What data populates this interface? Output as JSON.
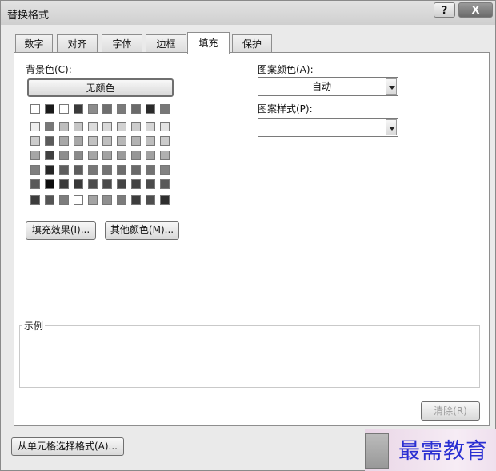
{
  "window": {
    "title": "替换格式",
    "help_label": "?",
    "close_label": "X"
  },
  "tabs": [
    {
      "label": "数字",
      "active": false
    },
    {
      "label": "对齐",
      "active": false
    },
    {
      "label": "字体",
      "active": false
    },
    {
      "label": "边框",
      "active": false
    },
    {
      "label": "填充",
      "active": true
    },
    {
      "label": "保护",
      "active": false
    }
  ],
  "fill": {
    "background_color_label": "背景色(C):",
    "no_color_button": "无颜色",
    "fill_effects_button": "填充效果(I)...",
    "more_colors_button": "其他颜色(M)...",
    "palette_top_row": [
      "#ffffff",
      "#1a1a1a",
      "#ffffff",
      "#3a3a3a",
      "#8c8c8c",
      "#6e6e6e",
      "#7a7a7a",
      "#6a6a6a",
      "#2a2a2a",
      "#777777"
    ],
    "palette_rows": [
      [
        "#eeeeee",
        "#777777",
        "#bdbdbd",
        "#c6c6c6",
        "#dcdcdc",
        "#d9d9d9",
        "#d2d2d2",
        "#cdcdcd",
        "#d6d6d6",
        "#e3e3e3"
      ],
      [
        "#cccccc",
        "#5b5b5b",
        "#a8a8a8",
        "#a7a7a7",
        "#c2c2c2",
        "#bfbfbf",
        "#b8b8b8",
        "#b3b3b3",
        "#bdbdbd",
        "#cbcbcb"
      ],
      [
        "#a6a6a6",
        "#404040",
        "#8e8e8e",
        "#8a8a8a",
        "#a5a5a5",
        "#a2a2a2",
        "#9b9b9b",
        "#979797",
        "#a1a1a1",
        "#b0b0b0"
      ],
      [
        "#7f7f7f",
        "#262626",
        "#5e5e5e",
        "#5d5d5d",
        "#777777",
        "#737373",
        "#6d6d6d",
        "#696969",
        "#727272",
        "#828282"
      ],
      [
        "#595959",
        "#0d0d0d",
        "#3a3a3a",
        "#393939",
        "#4c4c4c",
        "#4a4a4a",
        "#454545",
        "#434343",
        "#4b4b4b",
        "#585858"
      ],
      [
        "#3c3c3c",
        "#555555",
        "#7d7d7d",
        "#ffffff",
        "#a4a4a4",
        "#8f8f8f",
        "#7b7b7b",
        "#3d3d3d",
        "#4e4e4e",
        "#2e2e2e"
      ]
    ],
    "pattern_color_label": "图案颜色(A):",
    "pattern_color_value": "自动",
    "pattern_style_label": "图案样式(P):",
    "pattern_style_value": ""
  },
  "sample": {
    "label": "示例",
    "clear_button": "清除(R)"
  },
  "footer": {
    "from_cell_button": "从单元格选择格式(A)..."
  },
  "watermark": {
    "text": "最需教育"
  }
}
